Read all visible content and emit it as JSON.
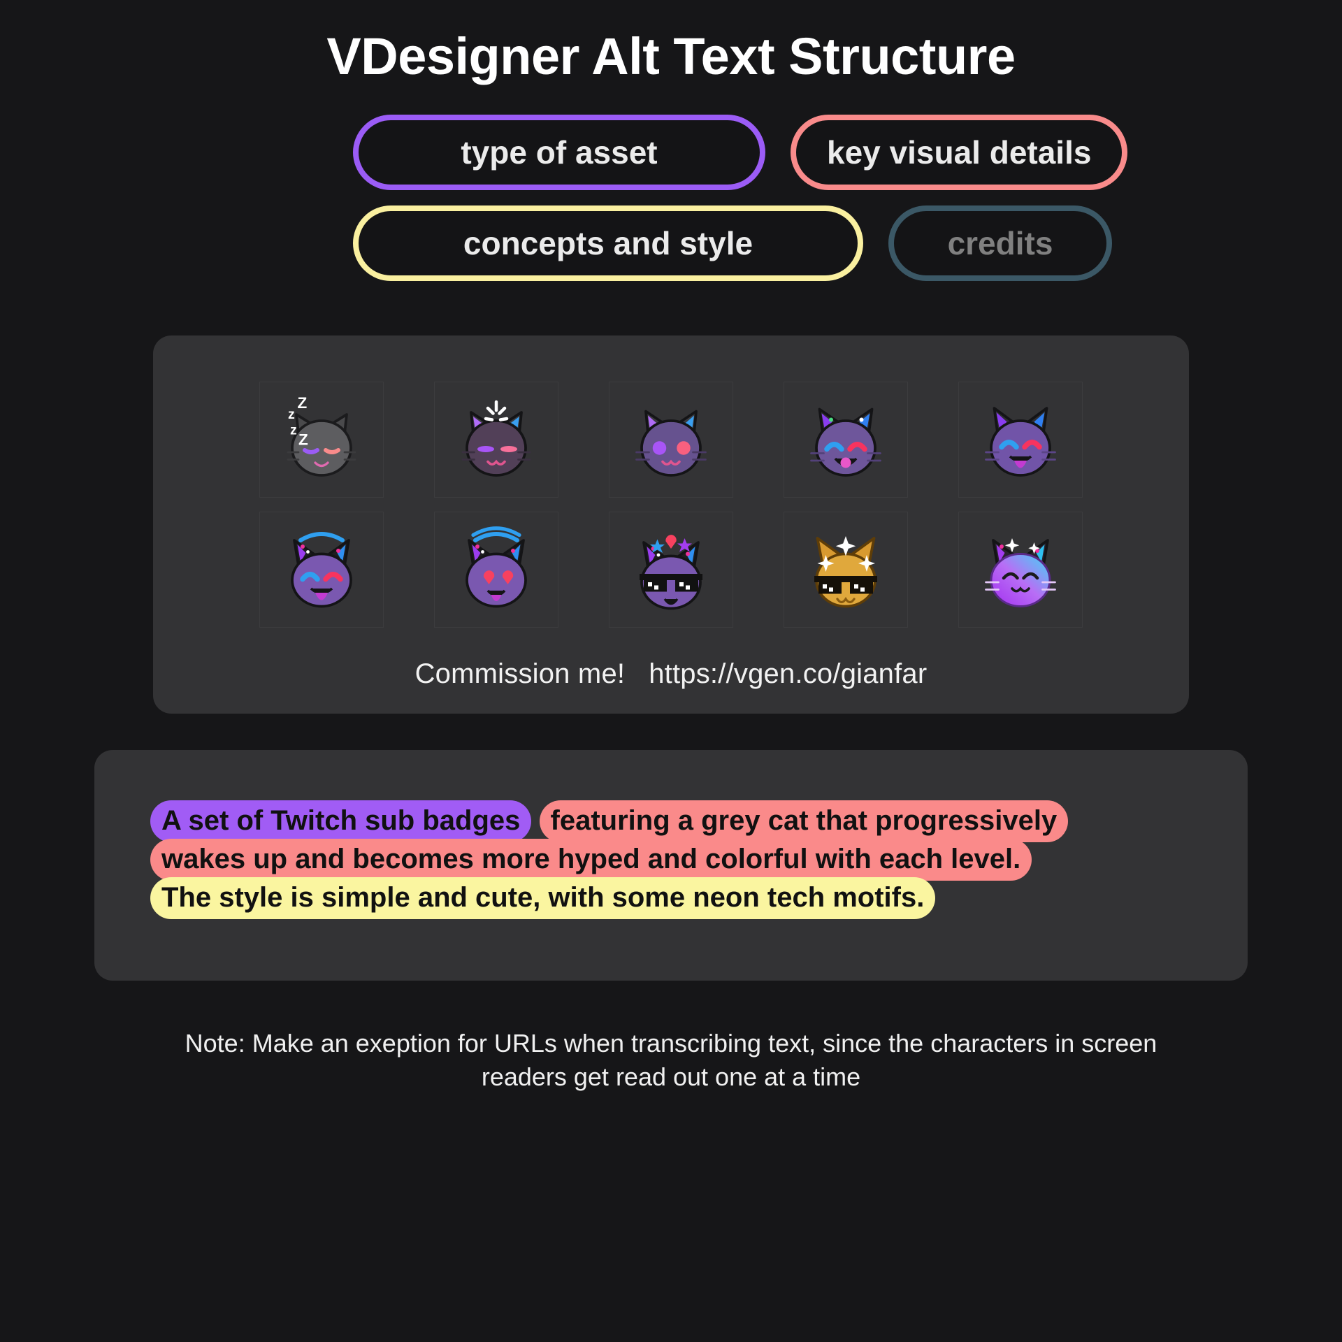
{
  "header": {
    "title": "VDesigner Alt Text Structure"
  },
  "tags": {
    "rows": [
      [
        {
          "label": "type of asset",
          "border_color": "#9b5cf6",
          "text_color": "#ebebeb",
          "name": "tag-type-of-asset"
        },
        {
          "label": "key visual details",
          "border_color": "#f98b8b",
          "text_color": "#ebebeb",
          "name": "tag-key-visual-details"
        }
      ],
      [
        {
          "label": "concepts and style",
          "border_color": "#faf0a0",
          "text_color": "#ebebeb",
          "name": "tag-concepts-and-style"
        },
        {
          "label": "credits",
          "border_color": "#3b5866",
          "text_color": "#808080",
          "name": "tag-credits"
        }
      ]
    ]
  },
  "showcase": {
    "emotes": [
      {
        "name": "emote-sleeping-grey-cat",
        "alt": "sleeping grey cat with Z z Z z"
      },
      {
        "name": "emote-waking-cat-sparkle",
        "alt": "waking purple cat with white sparkle"
      },
      {
        "name": "emote-neutral-cat-blush",
        "alt": "purple cat with purple and pink round cheeks"
      },
      {
        "name": "emote-happy-cat-open-mouth",
        "alt": "purple cat winking with open smile"
      },
      {
        "name": "emote-excited-cat-tongue",
        "alt": "purple cat with tongue out"
      },
      {
        "name": "emote-hyped-cat-blue-arc",
        "alt": "purple cat with blue arc and tongue out"
      },
      {
        "name": "emote-heart-eyes-cat",
        "alt": "purple cat with pink heart eyes"
      },
      {
        "name": "emote-deal-with-it-cat",
        "alt": "purple cat with pixel sunglasses, star and heart"
      },
      {
        "name": "emote-gold-sunglasses-cat",
        "alt": "gold cat with pixel sunglasses and sparkles"
      },
      {
        "name": "emote-rainbow-glow-cat",
        "alt": "glowing purple to cyan cat with sparkles"
      }
    ],
    "commission_label": "Commission me!",
    "commission_url": "https://vgen.co/gianfar"
  },
  "example": {
    "segments": [
      {
        "text": "A set of Twitch sub badges",
        "highlight": "purple",
        "name": "alt-segment-type-of-asset"
      },
      {
        "text": "featuring a grey cat that progressively wakes up and becomes more hyped and colorful with each level.",
        "highlight": "salmon",
        "name": "alt-segment-key-visual-details"
      },
      {
        "text": "The style is simple and cute, with some neon tech motifs.",
        "highlight": "yellow",
        "name": "alt-segment-concepts-and-style"
      }
    ],
    "highlight_colors": {
      "purple": "#a15cf5",
      "salmon": "#fa8a8a",
      "yellow": "#faf5a0"
    }
  },
  "footer": {
    "note": "Note: Make an exeption for URLs when transcribing text, since the characters in screen readers get read out one at a time"
  }
}
